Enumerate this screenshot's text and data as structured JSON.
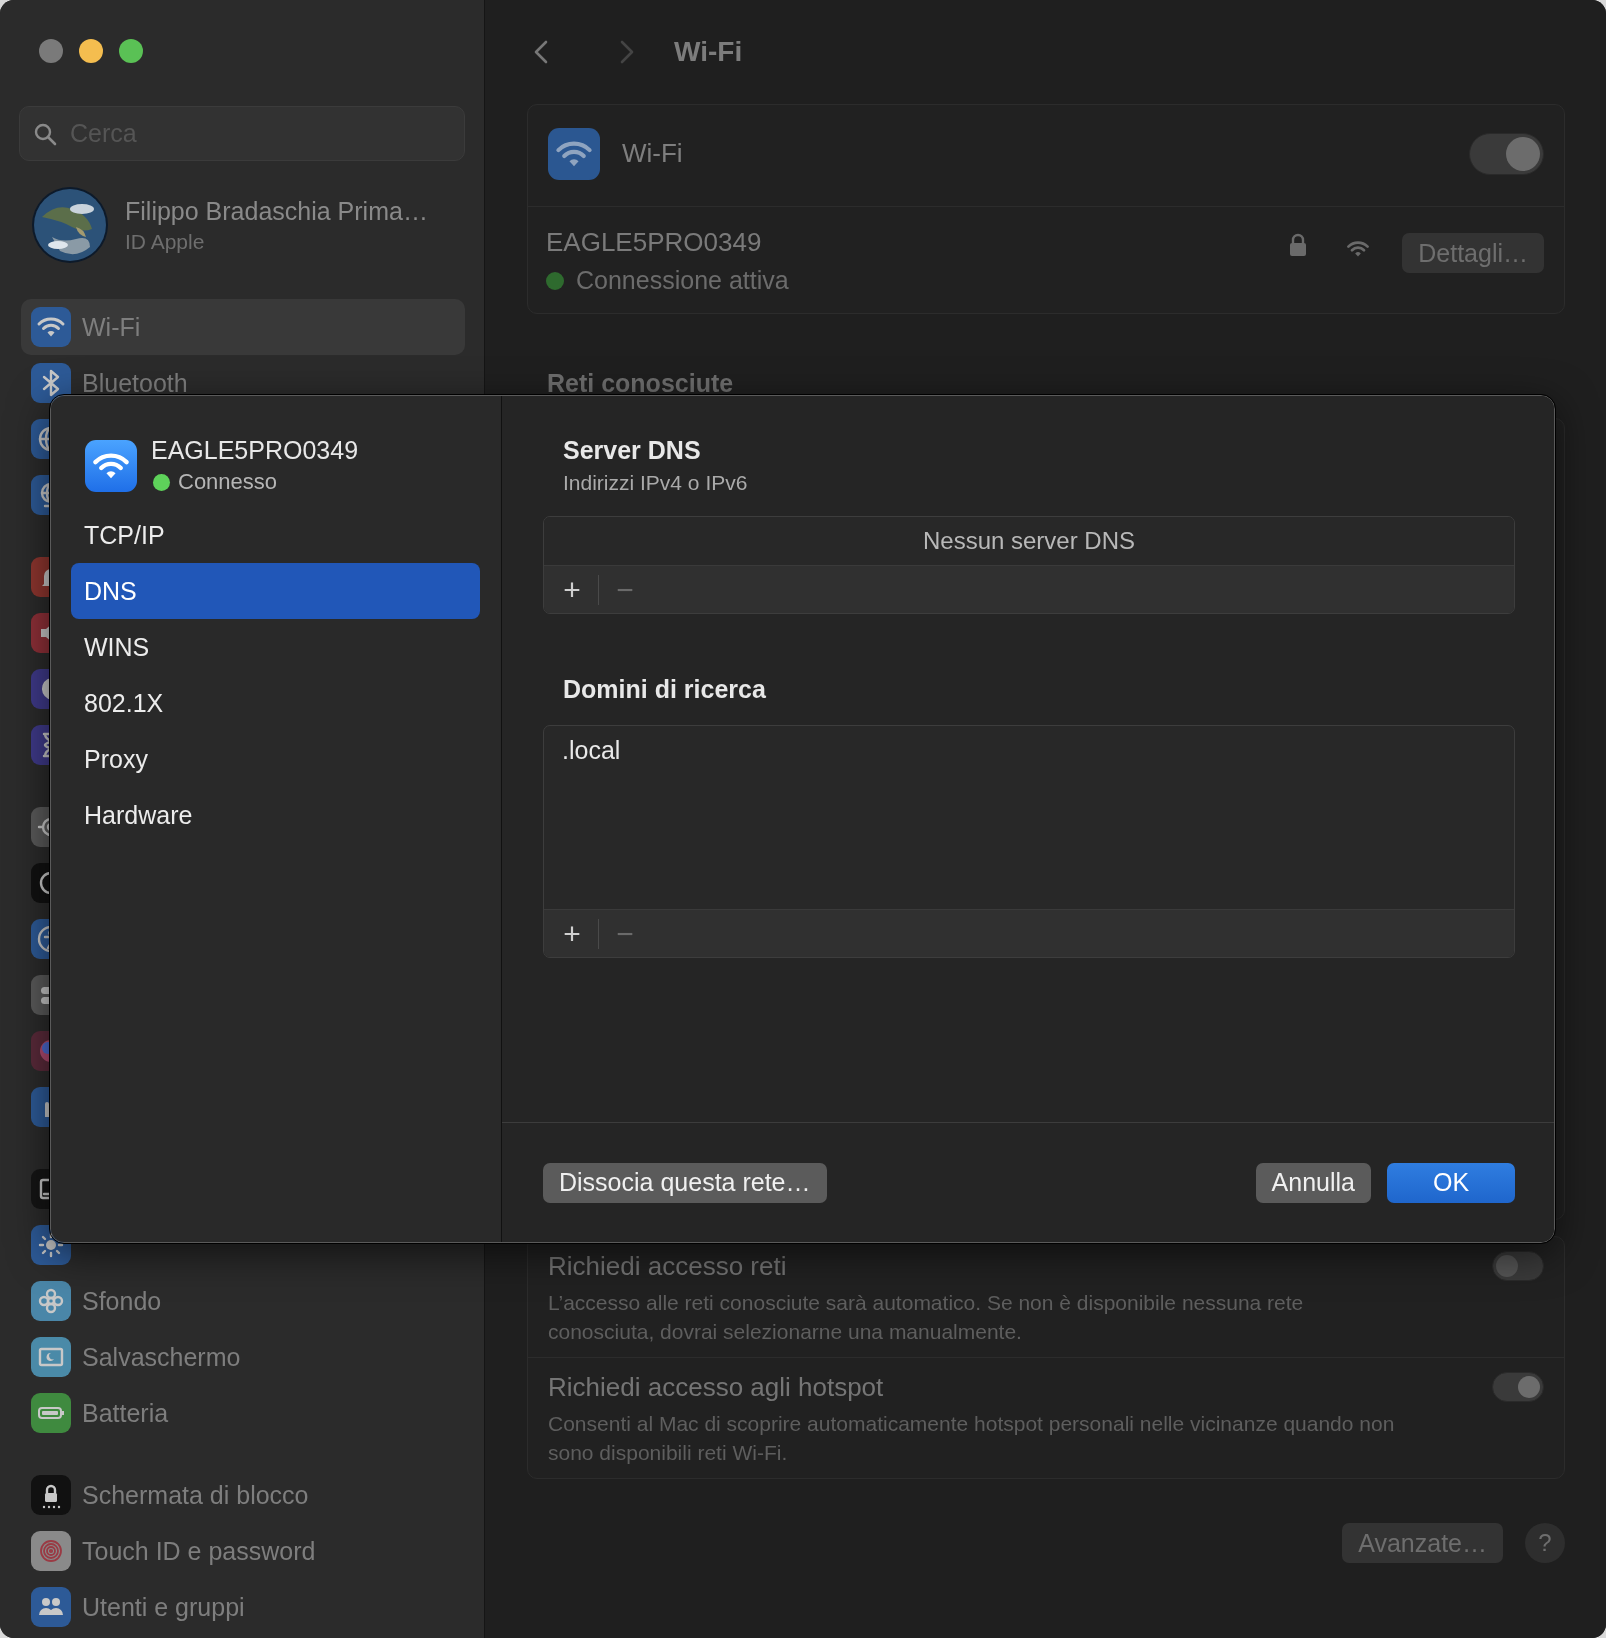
{
  "sidebar": {
    "search": {
      "placeholder": "Cerca"
    },
    "account": {
      "name": "Filippo Bradaschia Prima…",
      "subtitle": "ID Apple"
    },
    "sections": [
      {
        "items": [
          {
            "label": "Wi-Fi",
            "kind": "wifi",
            "color": "#2d5a97",
            "selected": true
          },
          {
            "label": "Bluetooth",
            "kind": "bluetooth",
            "color": "#2d5a97",
            "selected": false
          },
          {
            "kind": "globe",
            "selected": false
          },
          {
            "kind": "vpn",
            "selected": false
          }
        ]
      },
      {
        "items": [
          {
            "kind": "bell",
            "selected": false
          },
          {
            "kind": "speaker",
            "selected": false
          },
          {
            "kind": "moon",
            "selected": false
          },
          {
            "kind": "hourglass",
            "selected": false
          }
        ]
      },
      {
        "items": [
          {
            "kind": "gear",
            "selected": false
          },
          {
            "kind": "appearance",
            "selected": false
          },
          {
            "kind": "accessibility",
            "selected": false
          },
          {
            "kind": "switches",
            "selected": false
          },
          {
            "kind": "siri",
            "selected": false
          },
          {
            "kind": "hand",
            "selected": false
          }
        ]
      },
      {
        "items": [
          {
            "kind": "dock",
            "selected": false
          },
          {
            "kind": "sun",
            "color": "#2d5a97",
            "selected": false
          },
          {
            "label": "Sfondo",
            "kind": "flower",
            "color": "#4a86a8",
            "selected": false
          },
          {
            "label": "Salvaschermo",
            "kind": "screensaver",
            "color": "#4a8aa8",
            "selected": false
          },
          {
            "label": "Batteria",
            "kind": "battery",
            "color": "#3f8a3f",
            "selected": false
          }
        ]
      },
      {
        "items": [
          {
            "label": "Schermata di blocco",
            "kind": "lock",
            "color": "#111111",
            "selected": false
          },
          {
            "label": "Touch ID e password",
            "kind": "fingerprint",
            "color": "#8a8a8a",
            "selected": false
          },
          {
            "label": "Utenti e gruppi",
            "kind": "users",
            "color": "#2d5a97",
            "selected": false
          }
        ]
      }
    ]
  },
  "main": {
    "title": "Wi-Fi",
    "wifi": {
      "label": "Wi-Fi",
      "on": true
    },
    "network": {
      "name": "EAGLE5PRO0349",
      "status": "Connessione attiva",
      "details_button": "Dettagli…"
    },
    "known_networks_heading": "Reti conosciute",
    "options": [
      {
        "title": "Richiedi accesso reti",
        "description": "L’accesso alle reti conosciute sarà automatico. Se non è disponibile nessuna rete conosciuta, dovrai selezionarne una manualmente.",
        "on": false
      },
      {
        "title": "Richiedi accesso agli hotspot",
        "description": "Consenti al Mac di scoprire automaticamente hotspot personali nelle vicinanze quando non sono disponibili reti Wi-Fi.",
        "on": true
      }
    ],
    "advanced_button": "Avanzate…",
    "help_button": "?"
  },
  "sheet": {
    "network": {
      "name": "EAGLE5PRO0349",
      "status": "Connesso"
    },
    "tabs": [
      {
        "label": "TCP/IP",
        "selected": false
      },
      {
        "label": "DNS",
        "selected": true
      },
      {
        "label": "WINS",
        "selected": false
      },
      {
        "label": "802.1X",
        "selected": false
      },
      {
        "label": "Proxy",
        "selected": false
      },
      {
        "label": "Hardware",
        "selected": false
      }
    ],
    "dns_servers": {
      "title": "Server DNS",
      "subtitle": "Indirizzi IPv4 o IPv6",
      "placeholder": "Nessun server DNS",
      "add": {
        "label": "+",
        "disabled": false
      },
      "remove": {
        "label": "−",
        "disabled": true
      }
    },
    "search_domains": {
      "title": "Domini di ricerca",
      "entries": [
        ".local"
      ],
      "add": {
        "label": "+",
        "disabled": false
      },
      "remove": {
        "label": "−",
        "disabled": true
      }
    },
    "buttons": {
      "forget": "Dissocia questa rete…",
      "cancel": "Annulla",
      "ok": "OK"
    }
  }
}
